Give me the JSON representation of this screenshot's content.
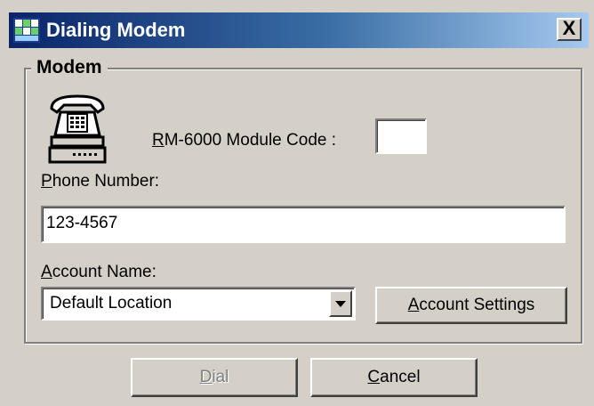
{
  "window": {
    "title": "Dialing Modem",
    "close_label": "X"
  },
  "modem_group": {
    "legend": "Modem",
    "module_code_label": "RM-6000 Module Code :",
    "module_code_value": "",
    "phone_label": "Phone Number:",
    "phone_value": "123-4567",
    "account_label": "Account Name:",
    "account_selected": "Default Location",
    "account_settings_label": "Account Settings"
  },
  "buttons": {
    "dial_label": "Dial",
    "dial_enabled": false,
    "cancel_label": "Cancel"
  },
  "icons": {
    "app": "modem-app-icon",
    "phone": "telephone-icon",
    "close": "close-icon",
    "dropdown": "chevron-down-icon"
  },
  "colors": {
    "title_start": "#0a246a",
    "title_end": "#a6caf0",
    "face": "#d4d0c8"
  }
}
